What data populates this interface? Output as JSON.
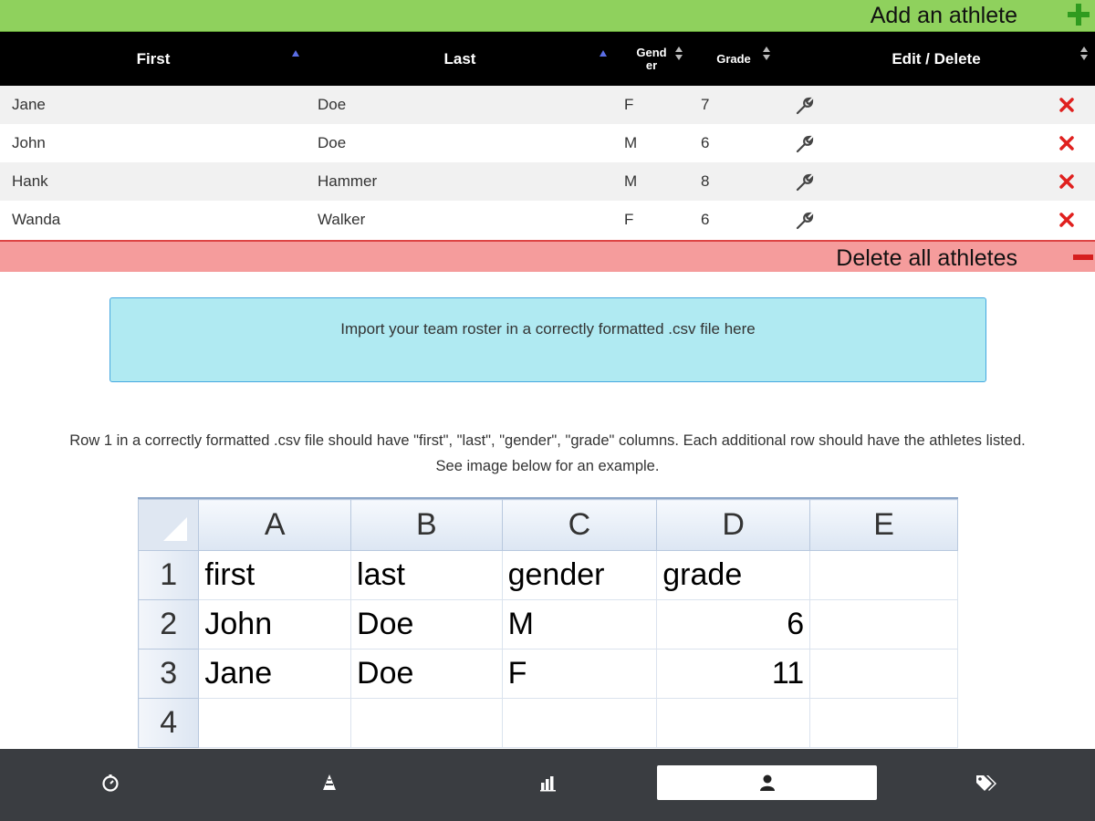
{
  "add_bar": {
    "label": "Add an athlete",
    "icon": "plus-icon"
  },
  "table": {
    "headers": {
      "first": "First",
      "last": "Last",
      "gender_line1": "Gend",
      "gender_line2": "er",
      "grade": "Grade",
      "actions": "Edit / Delete"
    },
    "rows": [
      {
        "first": "Jane",
        "last": "Doe",
        "gender": "F",
        "grade": "7"
      },
      {
        "first": "John",
        "last": "Doe",
        "gender": "M",
        "grade": "6"
      },
      {
        "first": "Hank",
        "last": "Hammer",
        "gender": "M",
        "grade": "8"
      },
      {
        "first": "Wanda",
        "last": "Walker",
        "gender": "F",
        "grade": "6"
      }
    ]
  },
  "delete_all_bar": {
    "label": "Delete all athletes",
    "icon": "minus-icon"
  },
  "import": {
    "label": "Import your team roster in a correctly formatted .csv file here"
  },
  "instructions": "Row 1 in a correctly formatted .csv file should have \"first\", \"last\", \"gender\", \"grade\" columns. Each additional row should have the athletes listed. See image below for an example.",
  "example_sheet": {
    "columns": [
      "A",
      "B",
      "C",
      "D",
      "E"
    ],
    "row_numbers": [
      "1",
      "2",
      "3",
      "4"
    ],
    "rows": [
      [
        "first",
        "last",
        "gender",
        "grade",
        ""
      ],
      [
        "John",
        "Doe",
        "M",
        "6",
        ""
      ],
      [
        "Jane",
        "Doe",
        "F",
        "11",
        ""
      ],
      [
        "",
        "",
        "",
        "",
        ""
      ]
    ]
  },
  "bottom_nav": {
    "items": [
      {
        "icon": "stopwatch-icon",
        "active": false
      },
      {
        "icon": "cones-icon",
        "active": false
      },
      {
        "icon": "bar-chart-icon",
        "active": false
      },
      {
        "icon": "user-icon",
        "active": true
      },
      {
        "icon": "tags-icon",
        "active": false
      }
    ]
  },
  "colors": {
    "add_bar": "#8fd15d",
    "delete_bar": "#f59c9c",
    "import_box": "#b0eaf2",
    "header": "#000000",
    "nav": "#3a3d41",
    "delete_x": "#e0201e"
  }
}
